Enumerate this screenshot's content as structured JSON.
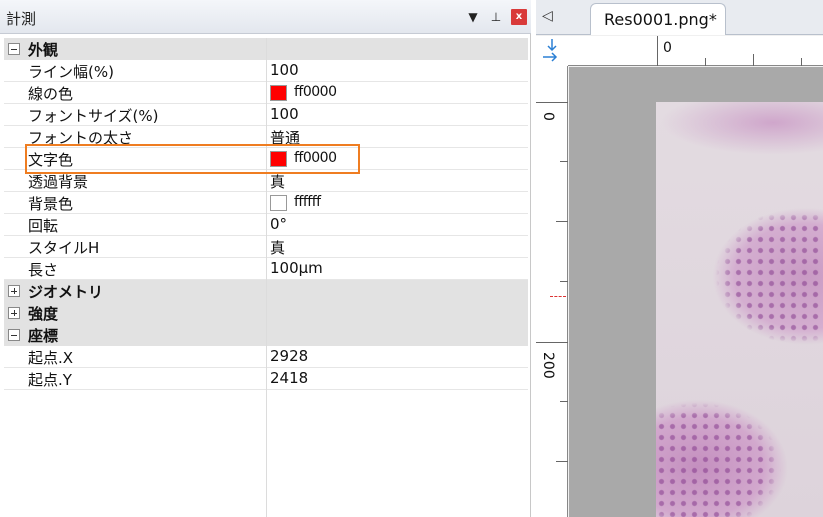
{
  "panel": {
    "title": "計測",
    "dropdown_icon": "▼",
    "pin_icon": "⊥",
    "close_icon": "x"
  },
  "categories": {
    "appearance": {
      "label": "外観",
      "expander": "minus",
      "props": [
        {
          "name": "ライン幅(%)",
          "value": "100"
        },
        {
          "name": "線の色",
          "value": "ff0000",
          "swatch": "#ff0000"
        },
        {
          "name": "フォントサイズ(%)",
          "value": "100"
        },
        {
          "name": "フォントの太さ",
          "value": "普通"
        },
        {
          "name": "文字色",
          "value": "ff0000",
          "swatch": "#ff0000"
        },
        {
          "name": "透過背景",
          "value": "真"
        },
        {
          "name": "背景色",
          "value": "ffffff",
          "swatch": "#ffffff"
        },
        {
          "name": "回転",
          "value": "0°"
        },
        {
          "name": "スタイルH",
          "value": "真"
        },
        {
          "name": "長さ",
          "value": "100μm"
        }
      ]
    },
    "geometry": {
      "label": "ジオメトリ",
      "expander": "plus"
    },
    "intensity": {
      "label": "強度",
      "expander": "plus"
    },
    "coordinates": {
      "label": "座標",
      "expander": "minus",
      "props": [
        {
          "name": "起点.X",
          "value": "2928"
        },
        {
          "name": "起点.Y",
          "value": "2418"
        }
      ]
    }
  },
  "document": {
    "tab_scroll_icon": "◁",
    "tab_label": "Res0001.png*",
    "ruler_top_label": "0",
    "ruler_left_labels": [
      "0",
      "200"
    ],
    "corner_icon": "↓→"
  },
  "colors": {
    "highlight": "#ef7d21",
    "accent": "#2a7fd4"
  }
}
